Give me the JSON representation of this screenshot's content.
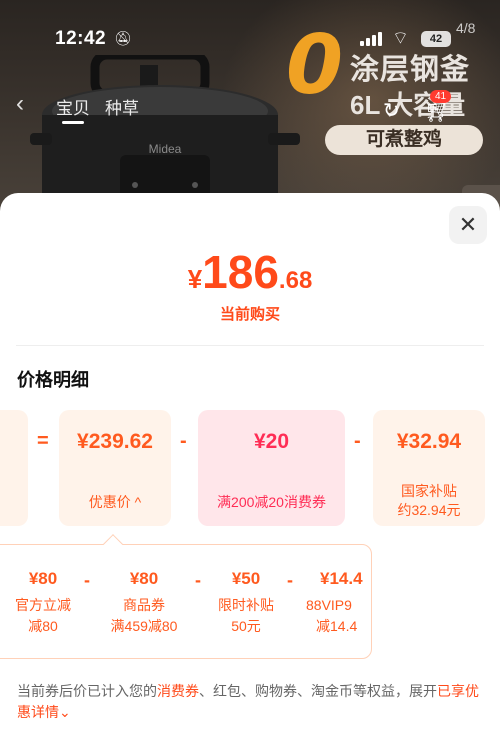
{
  "status_bar": {
    "time": "12:42",
    "battery": "42"
  },
  "hero": {
    "page_index": "4/8",
    "tabs": [
      "宝贝",
      "种草"
    ],
    "promo_zero": "0",
    "promo_line1": "涂层钢釜",
    "promo_line2": "6L 大容量",
    "cart_badge": "41",
    "promo_pill": "可煮整鸡",
    "brand": "Midea"
  },
  "sheet": {
    "close": "✕",
    "price": {
      "yen": "¥",
      "integer": "186",
      "decimal": ".68"
    },
    "price_label": "当前购买",
    "section_title": "价格明细",
    "cards": [
      {
        "amount": "¥239.62",
        "label": "优惠价 ^"
      },
      {
        "amount": "¥20",
        "label": "满200减20消费券"
      },
      {
        "amount": "¥32.94",
        "label_line1": "国家补贴",
        "label_line2": "约32.94元"
      }
    ],
    "operators": {
      "equals": "=",
      "minus": "-"
    },
    "details": [
      {
        "amount": "¥80",
        "line1": "官方立减",
        "line2": "减80"
      },
      {
        "amount": "¥80",
        "line1": "商品券",
        "line2": "满459减80"
      },
      {
        "amount": "¥50",
        "line1": "限时补贴",
        "line2": "50元"
      },
      {
        "amount": "¥14.4",
        "line1": "88VIP9",
        "line2": "减14.4"
      }
    ],
    "footnote": {
      "part1": "当前券后价已计入您的",
      "highlight1": "消费券",
      "part2": "、红包、购物券、淘金币等权益，展开",
      "highlight2": "已享优惠详情",
      "chevron": "⌄"
    }
  },
  "colors": {
    "accent": "#ff4a1a",
    "peach_card": "#fff3ea",
    "pink_card": "#ffe6ea"
  }
}
